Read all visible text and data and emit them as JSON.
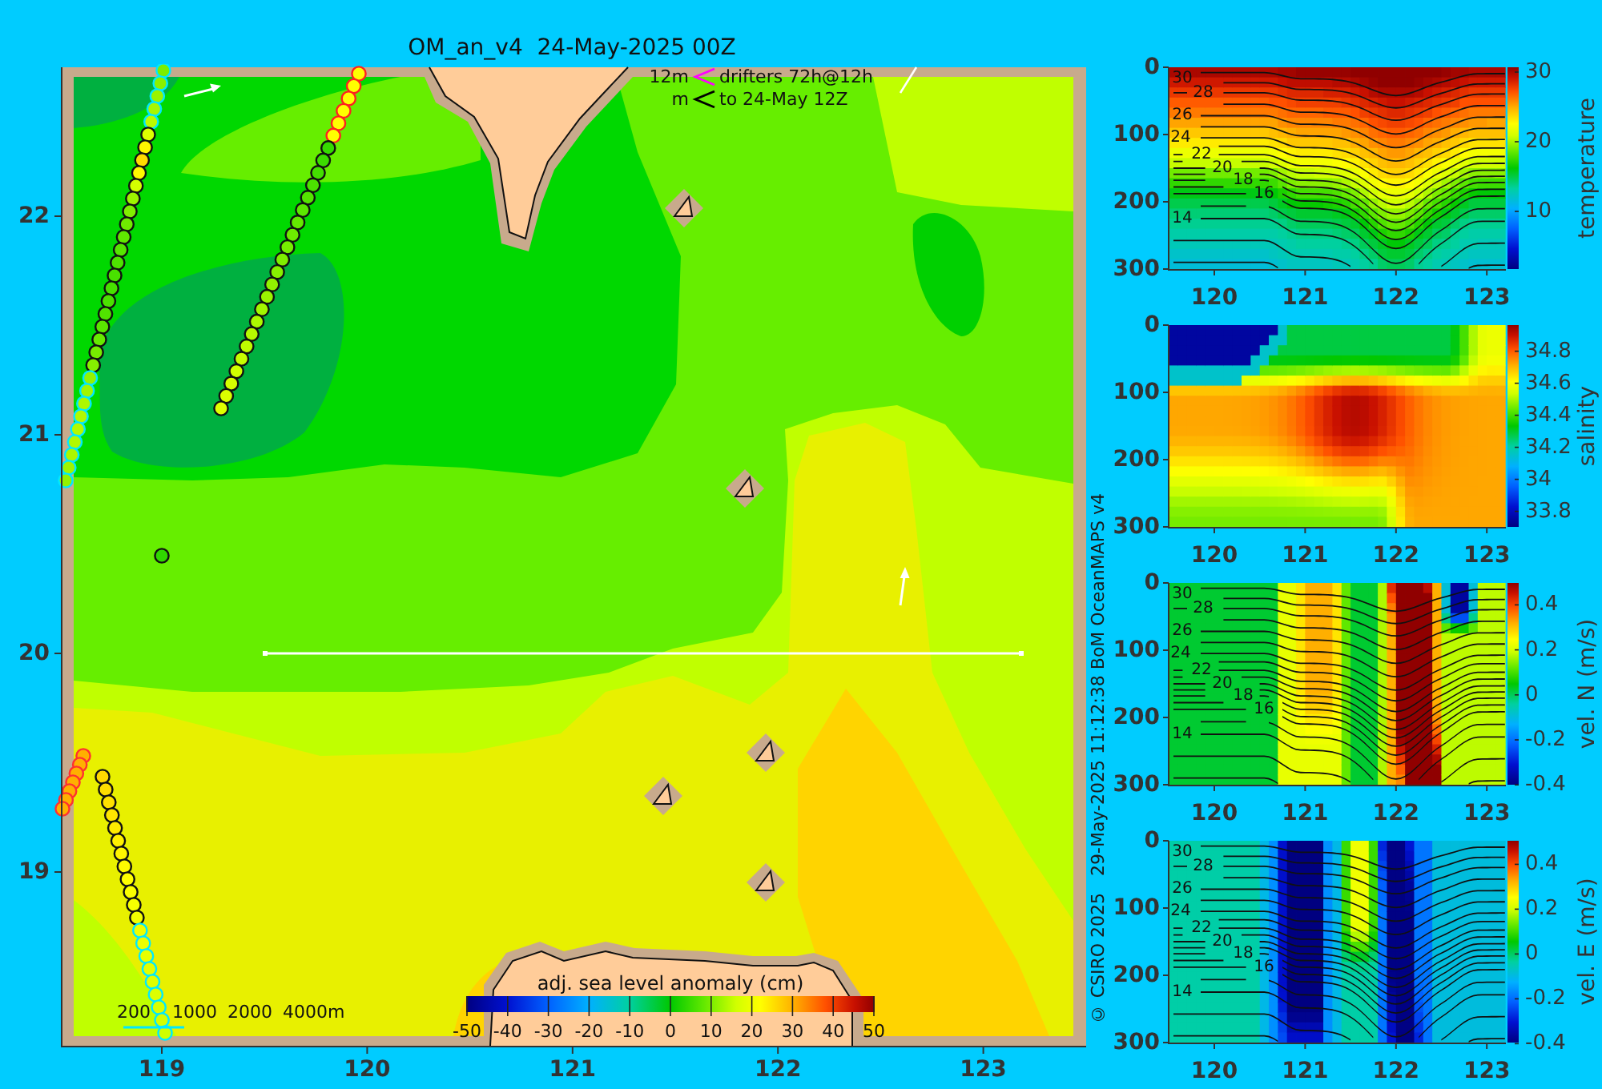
{
  "title": "OM_an_v4  24-May-2025 00Z",
  "map": {
    "drifter_legend": [
      {
        "kind": "recent",
        "length": "12m",
        "label": "drifters 72h@12h"
      },
      {
        "kind": "track",
        "length": "m",
        "label": "to 24-May 12Z"
      }
    ],
    "lat_ticks": [
      "22",
      "21",
      "20",
      "19"
    ],
    "lon_ticks": [
      "119",
      "120",
      "121",
      "122",
      "123"
    ],
    "depth_legend": [
      "200",
      "1000",
      "2000",
      "4000m"
    ],
    "colorbar": {
      "title": "adj. sea level anomaly (cm)",
      "ticks": [
        "-50",
        "-40",
        "-30",
        "-20",
        "-10",
        "0",
        "10",
        "20",
        "30",
        "40",
        "50"
      ]
    }
  },
  "credit": "© CSIRO 2025   29-May-2025 11:12:38 BoM OceanMAPS v4",
  "sections": [
    {
      "kind": "temperature",
      "label": "temperature",
      "depth_ticks": [
        "0",
        "100",
        "200",
        "300"
      ],
      "lon_ticks": [
        "120",
        "121",
        "122",
        "123"
      ],
      "colorbar_ticks": [
        "30",
        "20",
        "10"
      ],
      "contour_labels": [
        "30",
        "28",
        "26",
        "24",
        "22",
        "20",
        "18",
        "16",
        "14"
      ]
    },
    {
      "kind": "salinity",
      "label": "salinity",
      "depth_ticks": [
        "0",
        "100",
        "200",
        "300"
      ],
      "lon_ticks": [
        "120",
        "121",
        "122",
        "123"
      ],
      "colorbar_ticks": [
        "34.8",
        "34.6",
        "34.4",
        "34.2",
        "34",
        "33.8"
      ]
    },
    {
      "kind": "vel_n",
      "label": "vel. N (m/s)",
      "depth_ticks": [
        "0",
        "100",
        "200",
        "300"
      ],
      "lon_ticks": [
        "120",
        "121",
        "122",
        "123"
      ],
      "colorbar_ticks": [
        "0.4",
        "0.2",
        "0",
        "-0.2",
        "-0.4"
      ],
      "contour_labels": [
        "30",
        "28",
        "26",
        "24",
        "22",
        "20",
        "18",
        "16",
        "14"
      ]
    },
    {
      "kind": "vel_e",
      "label": "vel. E (m/s)",
      "depth_ticks": [
        "0",
        "100",
        "200",
        "300"
      ],
      "lon_ticks": [
        "120",
        "121",
        "122",
        "123"
      ],
      "colorbar_ticks": [
        "0.4",
        "0.2",
        "0",
        "-0.2",
        "-0.4"
      ],
      "contour_labels": [
        "30",
        "28",
        "26",
        "24",
        "22",
        "20",
        "18",
        "16",
        "14"
      ]
    }
  ]
}
